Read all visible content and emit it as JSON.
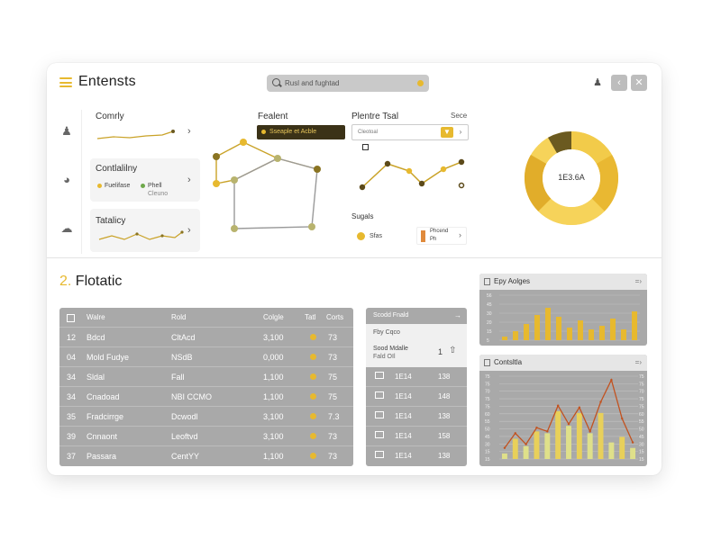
{
  "header": {
    "title": "Entensts",
    "search_text": "Rusl and fughtad",
    "user_icon": "user-icon",
    "buttons": [
      "back-icon",
      "close-icon"
    ]
  },
  "sidebar": {
    "icons": [
      "user-icon",
      "dashboard-icon",
      "cloud-icon"
    ]
  },
  "cards": [
    {
      "label": "Comrly"
    },
    {
      "label": "Contlalilny",
      "legend": [
        "Fuelifase",
        "Phell"
      ],
      "sub": "Cleuno"
    },
    {
      "label": "Tatalicy"
    }
  ],
  "network": {
    "title": "Fealent",
    "tag": "Sseaple et Acble"
  },
  "panel_mid": {
    "title": "Plentre Tsal",
    "right_label": "Sece",
    "input_text": "Cleotoal",
    "section": "Sugals",
    "legend_left": "Sfas",
    "legend_right_top": "Phcend",
    "legend_right_bottom": "Ph"
  },
  "donut": {
    "center_label": "1E3.6A",
    "colors": [
      "#f6d35a",
      "#e9b832",
      "#f2cb4a",
      "#6b5a20",
      "#d9a625"
    ]
  },
  "lower": {
    "title_num": "2.",
    "title": "Flotatic"
  },
  "table": {
    "headers": [
      "Walre",
      "Rold",
      "Colgle",
      "Tatl",
      "Corts"
    ],
    "rows": [
      [
        "12",
        "Bdcd",
        "CltAcd",
        "3,100",
        "73"
      ],
      [
        "04",
        "Mold Fudye",
        "NSdB",
        "0,000",
        "73"
      ],
      [
        "34",
        "Sldal",
        "Fall",
        "1,100",
        "75"
      ],
      [
        "34",
        "Cnadoad",
        "NBI CCMO",
        "1,100",
        "75"
      ],
      [
        "35",
        "Fradcirrge",
        "Dcwodl",
        "3,100",
        "7.3"
      ],
      [
        "39",
        "Cnnaont",
        "Leoftvd",
        "3,100",
        "73"
      ],
      [
        "37",
        "Passara",
        "CentYY",
        "1,100",
        "73"
      ]
    ]
  },
  "panel2": {
    "header": "Scodd Fnald",
    "subtitle": "Fby Cqco",
    "item_title": "Sood Mdalle",
    "item_sub": "Fald OIl",
    "item_count": "1",
    "rows": [
      [
        "1E14",
        "138"
      ],
      [
        "1E14",
        "148"
      ],
      [
        "1E14",
        "138"
      ],
      [
        "1E14",
        "158"
      ],
      [
        "1E14",
        "138"
      ]
    ]
  },
  "chart_top_title": "Epy Aolges",
  "chart_bottom_title": "Contsltla",
  "chart_data": [
    {
      "type": "bar",
      "title": "Epy Aolges",
      "ylim": [
        0,
        50
      ],
      "ytick_labels": [
        "56",
        "45",
        "30",
        "20",
        "15",
        "5"
      ],
      "grid": true,
      "values": [
        4,
        10,
        18,
        28,
        36,
        26,
        14,
        22,
        12,
        16,
        24,
        12,
        32
      ]
    },
    {
      "type": "bar",
      "title": "Contsltla",
      "ylim": [
        0,
        90
      ],
      "ytick_labels": [
        "75",
        "75",
        "70",
        "75",
        "75",
        "60",
        "55",
        "50",
        "45",
        "30",
        "15",
        "15"
      ],
      "grid": true,
      "series": [
        {
          "values": [
            6,
            22,
            14,
            30,
            28,
            52,
            36,
            50,
            28,
            50,
            18,
            24,
            12
          ]
        },
        {
          "values": [
            12,
            28,
            16,
            34,
            30,
            58,
            38,
            56,
            30,
            62,
            86,
            44,
            18
          ]
        }
      ]
    }
  ]
}
